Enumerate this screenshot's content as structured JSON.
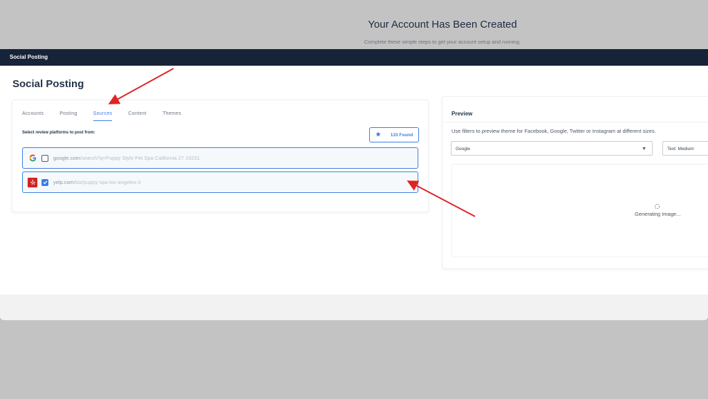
{
  "hero": {
    "title": "Your Account Has Been Created",
    "subtitle": "Complete these simple steps to get your account setup and running."
  },
  "topbar": {
    "title": "Social Posting"
  },
  "page": {
    "title": "Social Posting"
  },
  "tabs": [
    {
      "label": "Accounts",
      "active": false
    },
    {
      "label": "Posting",
      "active": false
    },
    {
      "label": "Sources",
      "active": true
    },
    {
      "label": "Content",
      "active": false
    },
    {
      "label": "Themes",
      "active": false
    }
  ],
  "sources": {
    "prompt": "Select review platforms to post from:",
    "found_label": "133 Found",
    "found_icon": "star-icon",
    "items": [
      {
        "platform": "google",
        "icon": "google-icon",
        "checked": false,
        "domain": "google.com",
        "path": "/search?q=Puppy Style Pet Spa California 27 10231"
      },
      {
        "platform": "yelp",
        "icon": "yelp-icon",
        "checked": true,
        "domain": "yelp.com",
        "path": "/biz/puppy-spa-los-angeles-3"
      }
    ]
  },
  "preview": {
    "title": "Preview",
    "description": "Use filters to preview theme for Facebook, Google, Twitter or Instagram at different sizes.",
    "platform_select": "Google",
    "size_select": "Text: Medium",
    "status": "Generating Image..."
  },
  "colors": {
    "accent": "#3d7de3",
    "topbar": "#172338",
    "annotation_arrow": "#e02424",
    "yelp": "#d32323"
  }
}
